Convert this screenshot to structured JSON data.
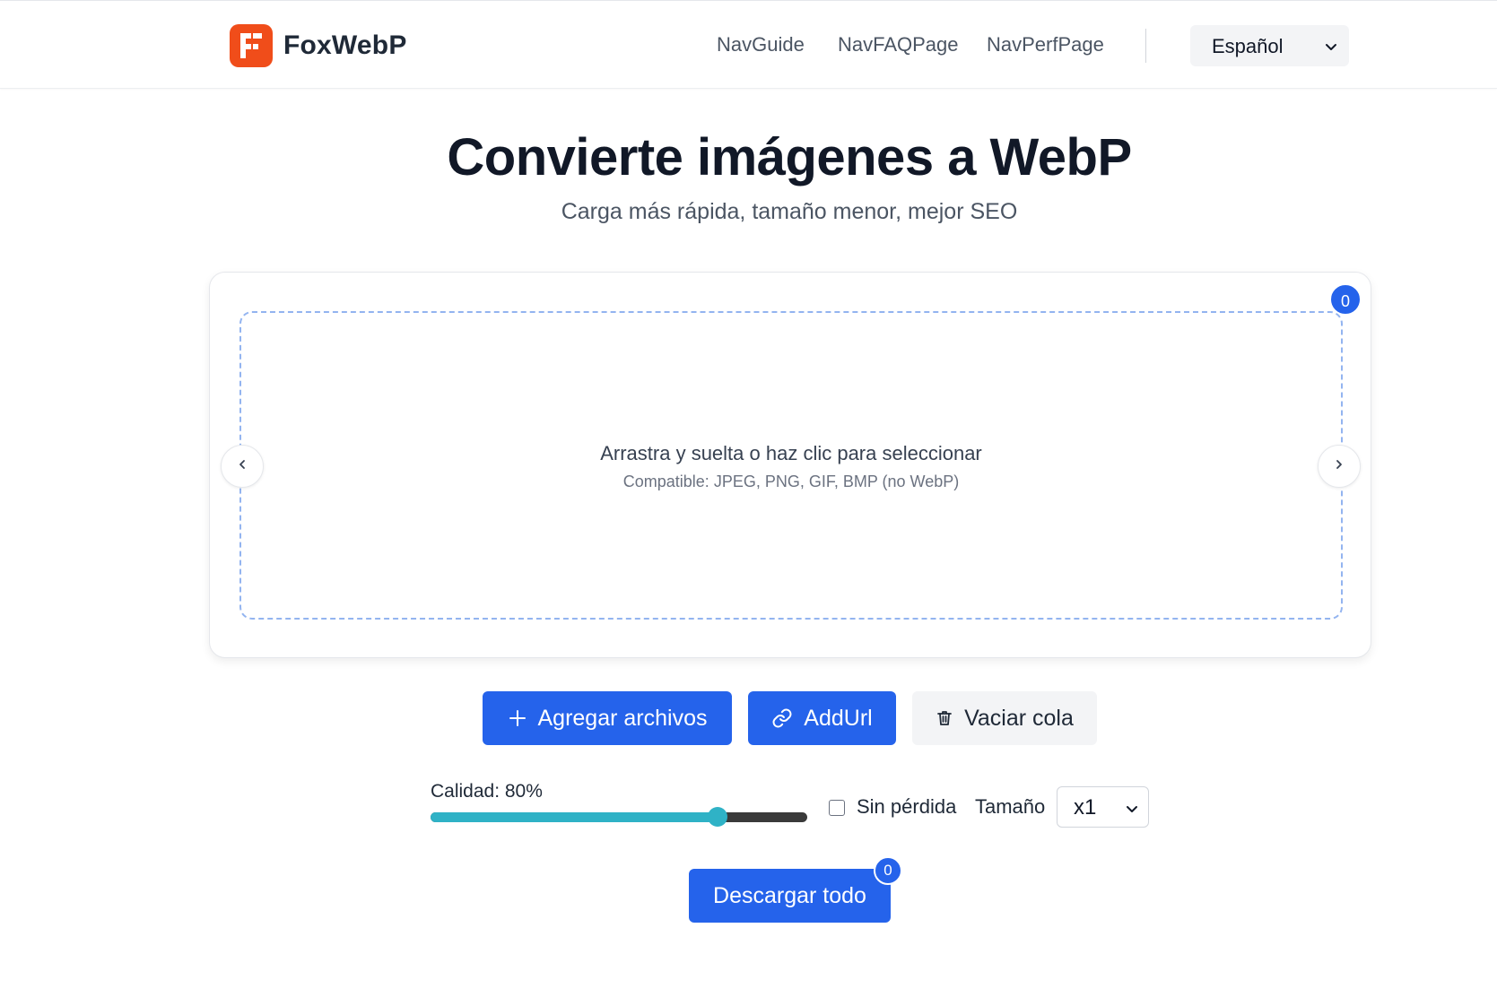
{
  "header": {
    "brand_name": "FoxWebP",
    "nav": [
      {
        "label": "NavGuide"
      },
      {
        "label": "NavFAQPage"
      },
      {
        "label": "NavPerfPage"
      }
    ],
    "language": "Español"
  },
  "hero": {
    "title": "Convierte imágenes a WebP",
    "subtitle": "Carga más rápida, tamaño menor, mejor SEO"
  },
  "dropzone": {
    "title": "Arrastra y suelta o haz clic para seleccionar",
    "hint": "Compatible: JPEG, PNG, GIF, BMP (no WebP)",
    "queue_count": "0",
    "prev_icon": "chevron-left-icon",
    "next_icon": "chevron-right-icon"
  },
  "actions": {
    "add_files": "Agregar archivos",
    "add_url": "AddUrl",
    "clear_queue": "Vaciar cola"
  },
  "settings": {
    "quality_label": "Calidad: 80%",
    "quality_value": 80,
    "lossless_label": "Sin pérdida",
    "lossless_checked": false,
    "size_label": "Tamaño",
    "size_value": "x1"
  },
  "download": {
    "label": "Descargar todo",
    "count": "0"
  },
  "colors": {
    "primary": "#2563eb",
    "brand": "#f04d1a",
    "slider": "#2fb2c6"
  }
}
